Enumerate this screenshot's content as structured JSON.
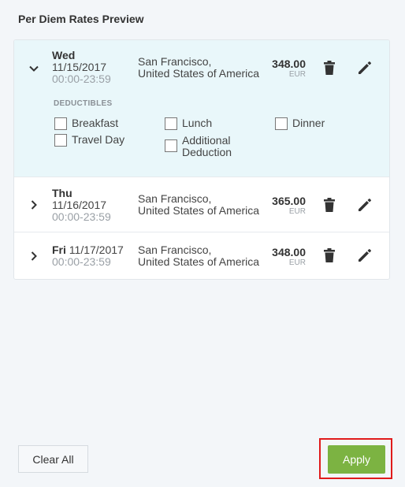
{
  "panel": {
    "title": "Per Diem Rates Preview"
  },
  "rows": [
    {
      "day": "Wed",
      "date": "11/15/2017",
      "time": "00:00-23:59",
      "location_line1": "San Francisco,",
      "location_line2": "United States of America",
      "amount": "348.00",
      "currency": "EUR",
      "expanded": true,
      "deductibles": {
        "title": "DEDUCTIBLES",
        "options": [
          "Breakfast",
          "Lunch",
          "Dinner",
          "Travel Day",
          "Additional Deduction"
        ]
      }
    },
    {
      "day": "Thu",
      "date": "11/16/2017",
      "time": "00:00-23:59",
      "location_line1": "San Francisco,",
      "location_line2": "United States of America",
      "amount": "365.00",
      "currency": "EUR",
      "expanded": false
    },
    {
      "day": "Fri",
      "date": "11/17/2017",
      "time": "00:00-23:59",
      "location_line1": "San Francisco,",
      "location_line2": "United States of America",
      "amount": "348.00",
      "currency": "EUR",
      "expanded": false
    }
  ],
  "footer": {
    "clear_label": "Clear All",
    "apply_label": "Apply"
  },
  "colors": {
    "apply": "#7cb342",
    "highlight": "#e01b1b",
    "expanded_bg": "#e9f7fa"
  },
  "icons": {
    "expand": "chevron-down-icon",
    "collapse": "chevron-right-icon",
    "delete": "trash-icon",
    "edit": "pencil-icon"
  }
}
